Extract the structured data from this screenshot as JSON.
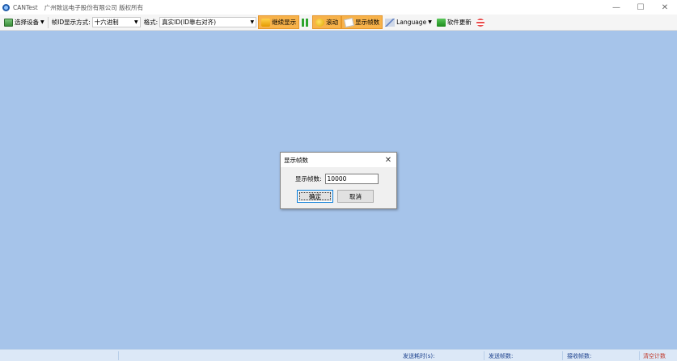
{
  "window": {
    "app_name": "CANTest",
    "subtitle": "广州致远电子股份有限公司 版权所有",
    "minimize_glyph": "—",
    "maximize_glyph": "☐",
    "close_glyph": "✕"
  },
  "toolbar": {
    "select_device": "选择设备",
    "id_mode_label": "帧ID显示方式:",
    "id_mode_value": "十六进制",
    "format_label": "格式:",
    "format_value": "真实ID(ID靠右对齐)",
    "continue_display": "继续显示",
    "scroll": "滚动",
    "show_frames": "显示帧数",
    "language": "Language",
    "software_update": "软件更新"
  },
  "dialog": {
    "title": "显示帧数",
    "frames_label": "显示帧数:",
    "frames_value": "10000",
    "ok_label": "确定",
    "cancel_label": "取消",
    "close_glyph": "✕"
  },
  "statusbar": {
    "send_time_label": "发送耗时(s):",
    "send_frames_label": "发送帧数:",
    "recv_frames_label": "接收帧数:",
    "clear_count": "清空计数"
  },
  "colors": {
    "workspace": "#a6c4ea",
    "active_button": "#f7b24a",
    "statusbar": "#dce8f7"
  }
}
